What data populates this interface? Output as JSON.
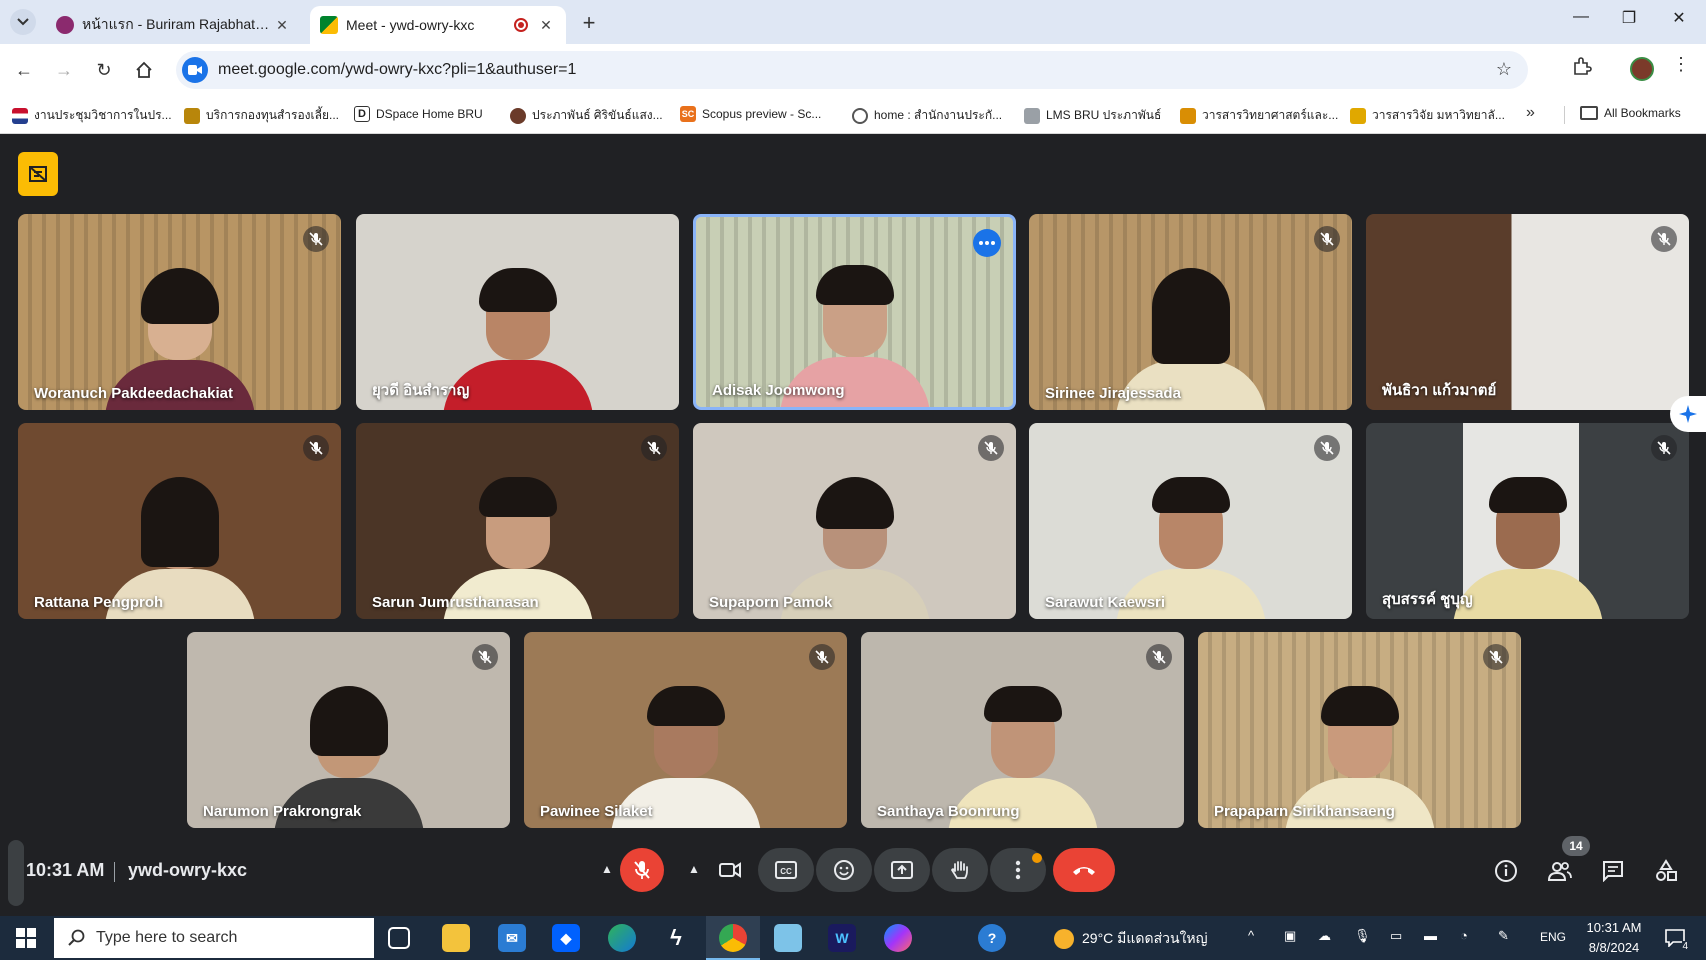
{
  "browser": {
    "tabs": [
      {
        "title": "หน้าแรก - Buriram Rajabhat Univ",
        "active": false
      },
      {
        "title": "Meet - ywd-owry-kxc",
        "active": true
      }
    ],
    "url": "meet.google.com/ywd-owry-kxc?pli=1&authuser=1",
    "bookmarks": [
      "งานประชุมวิชาการในปร...",
      "บริการกองทุนสำรองเลี้ย...",
      "DSpace Home BRU",
      "ประภาพันธ์ ศิริขันธ์แสง...",
      "Scopus preview - Sc...",
      "home : สำนักงานประกั...",
      "LMS BRU ประภาพันธ์",
      "วารสารวิทยาศาสตร์และ...",
      "วารสารวิจัย มหาวิทยาลั..."
    ],
    "all_bookmarks": "All Bookmarks"
  },
  "meet": {
    "participants": [
      {
        "name": "Woranuch Pakdeedachakiat",
        "muted": true
      },
      {
        "name": "ยุวดี อินสำราญ",
        "muted": false
      },
      {
        "name": "Adisak Joomwong",
        "muted": false,
        "speaking": true
      },
      {
        "name": "Sirinee Jirajessada",
        "muted": true
      },
      {
        "name": "พันธิวา แก้วมาตย์",
        "muted": true
      },
      {
        "name": "Rattana Pengproh",
        "muted": true
      },
      {
        "name": "Sarun Jumrusthanasan",
        "muted": true
      },
      {
        "name": "Supaporn Pamok",
        "muted": true
      },
      {
        "name": "Sarawut Kaewsri",
        "muted": true
      },
      {
        "name": "สุบสรรค์ ชูบุญ",
        "muted": true
      },
      {
        "name": "Narumon Prakrongrak",
        "muted": true
      },
      {
        "name": "Pawinee Silaket",
        "muted": true
      },
      {
        "name": "Santhaya Boonrung",
        "muted": true
      },
      {
        "name": "Prapaparn Sirikhansaeng",
        "muted": true
      }
    ],
    "time": "10:31 AM",
    "meeting_code": "ywd-owry-kxc",
    "participant_count": "14"
  },
  "taskbar": {
    "search_placeholder": "Type here to search",
    "weather": "29°C  มีแดดส่วนใหญ่",
    "language": "ENG",
    "time": "10:31 AM",
    "date": "8/8/2024",
    "notifications": "4"
  },
  "colors": {
    "meet_bg": "#202124",
    "end_call": "#ea4335",
    "speaking_border": "#8ab4f8",
    "accent": "#1a73e8"
  }
}
